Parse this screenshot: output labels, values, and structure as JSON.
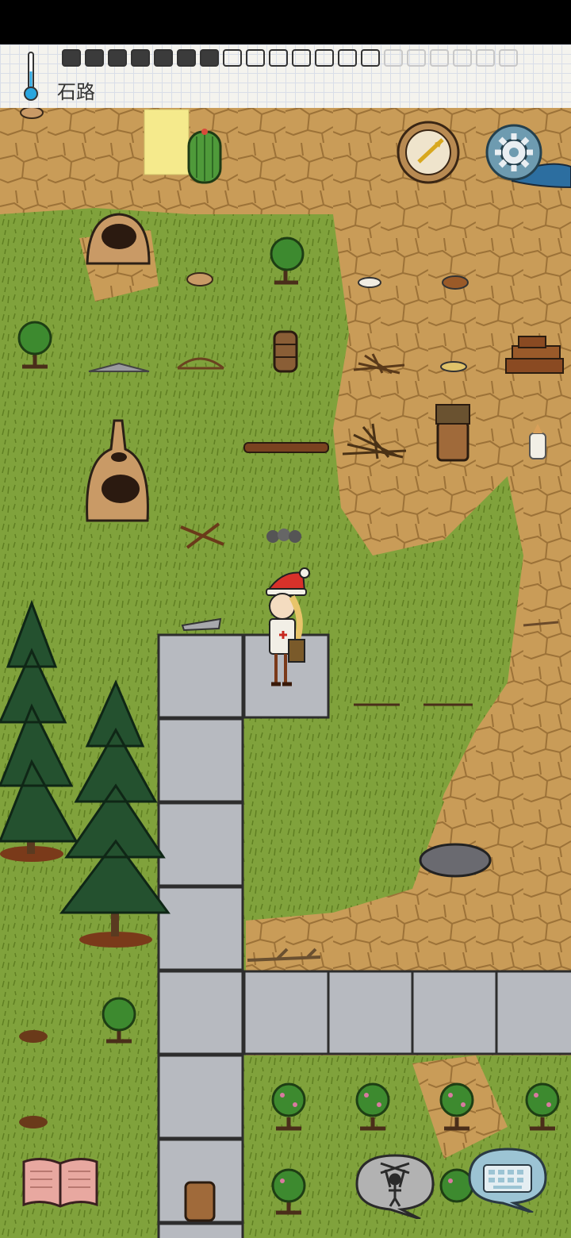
{
  "hud": {
    "location_label": "石路",
    "temperature_icon": "thermometer-icon",
    "food_meter": {
      "filled": 7,
      "empty": 7,
      "faded": 6
    }
  },
  "controls": {
    "compass_icon": "compass-icon",
    "settings_icon": "gear-icon",
    "recipe_book_icon": "book-icon",
    "emote_icon": "puppet-icon",
    "keyboard_icon": "keyboard-icon"
  },
  "colors": {
    "grass": "#7fa13a",
    "dirt": "#c89a54",
    "stone_path": "#b9bcc2",
    "hud_paper": "#f4f3ee"
  }
}
